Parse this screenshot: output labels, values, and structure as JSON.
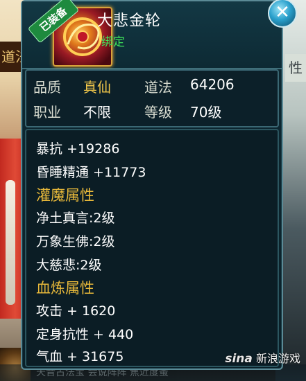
{
  "item": {
    "name": "大悲金轮",
    "equipped_tag": "已装备",
    "bind_status": "绑定"
  },
  "info": {
    "quality_label": "品质",
    "quality_value": "真仙",
    "dao_label": "道法",
    "dao_value": "64206",
    "job_label": "职业",
    "job_value": "不限",
    "level_label": "等级",
    "level_value": "70级"
  },
  "stats": {
    "crit_resist": "暴抗 +19286",
    "sleep_mastery": "昏睡精通 +11773",
    "infuse_title": "灌魔属性",
    "infuse": [
      "净土真言:2级",
      "万象生佛:2级",
      "大慈悲:2级"
    ],
    "blood_title": "血炼属性",
    "blood": [
      "攻击 + 1620",
      "定身抗性 + 440",
      "气血 + 31675"
    ]
  },
  "background": {
    "left_sign": "道法",
    "right_sign": "性",
    "bottom_text": "天音古法宝  会说阵阵  焦近度蚤"
  },
  "watermark": {
    "brand": "sina",
    "text": "新浪游戏"
  }
}
